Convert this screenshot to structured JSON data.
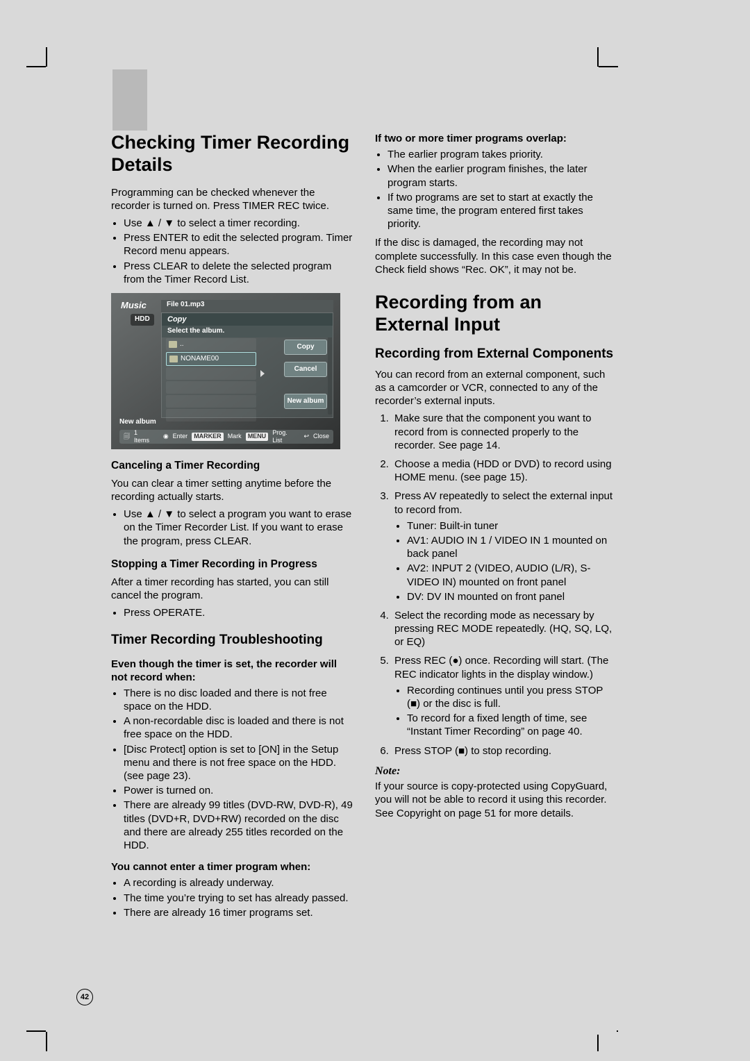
{
  "page_number": "42",
  "osd": {
    "music_label": "Music",
    "hdd_label": "HDD",
    "filebar": "File 01.mp3",
    "win_title": "Copy",
    "win_sub": "Select the album.",
    "row_up": "..",
    "row_noname": "NONAME00",
    "btn_copy": "Copy",
    "btn_cancel": "Cancel",
    "btn_newalbum": "New album",
    "new_album_side": "New album",
    "footer_items": "1 Items",
    "footer_enter": "Enter",
    "footer_marker": "MARKER",
    "footer_mark": "Mark",
    "footer_menu": "MENU",
    "footer_proglist": "Prog. List",
    "footer_close": "Close"
  },
  "col1": {
    "h1": "Checking Timer Recording Details",
    "p_intro": "Programming can be checked whenever the recorder is turned on. Press TIMER REC twice.",
    "b_intro": [
      "Use ▲ / ▼ to select a timer recording.",
      "Press ENTER to edit the selected program. Timer Record menu appears.",
      "Press CLEAR to delete the selected program from the Timer Record List."
    ],
    "h3_cancel": "Canceling a Timer Recording",
    "p_cancel": "You can clear a timer setting anytime before the recording actually starts.",
    "b_cancel": [
      "Use ▲ / ▼ to select a program you want to erase on the Timer Recorder List. If you want to erase the program, press CLEAR."
    ],
    "h3_stop": "Stopping a Timer Recording in Progress",
    "p_stop": "After a timer recording has started, you can still cancel the program.",
    "b_stop": [
      "Press OPERATE."
    ],
    "h2_trouble": "Timer Recording Troubleshooting",
    "h4_even": "Even though the timer is set, the recorder will not record when:",
    "b_even": [
      "There is no disc loaded and there is not free space on the HDD.",
      "A non-recordable disc is loaded and there is not free space on the HDD.",
      "[Disc Protect] option is set to [ON] in the Setup menu and there is not free space on the HDD. (see page 23).",
      "Power is turned on.",
      "There are already 99 titles (DVD-RW, DVD-R), 49 titles (DVD+R, DVD+RW) recorded on the disc and there are already 255 titles recorded on the HDD."
    ],
    "h4_cannot": "You cannot enter a timer program when:",
    "b_cannot": [
      "A recording is already underway.",
      "The time you’re trying to set has already passed.",
      "There are already 16 timer programs set."
    ]
  },
  "col2": {
    "h4_overlap": "If two or more timer programs overlap:",
    "b_overlap": [
      "The earlier program takes priority.",
      "When the earlier program finishes, the later program starts.",
      "If two programs are set to start at exactly the same time, the program entered first takes priority."
    ],
    "p_damaged": "If the disc is damaged, the recording may not complete successfully. In this case even though the Check field shows “Rec. OK”, it may not be.",
    "h1_ext": "Recording from an External Input",
    "h2_ext_comp": "Recording from External Components",
    "p_ext_intro": "You can record from an external component, such as a camcorder or VCR, connected to any of the recorder’s external inputs.",
    "steps": [
      "Make sure that the component you want to record from is connected properly to the recorder. See page 14.",
      "Choose a media (HDD or DVD) to record using HOME menu. (see page 15).",
      "Press AV repeatedly to select the external input to record from.",
      "Select the recording mode as necessary by pressing REC MODE repeatedly. (HQ, SQ, LQ, or EQ)",
      "Press REC (●) once.\nRecording will start. (The REC indicator lights in the display window.)",
      "Press STOP (■) to stop recording."
    ],
    "step3_sub": [
      "Tuner: Built-in tuner",
      "AV1: AUDIO IN 1 / VIDEO IN 1 mounted on back panel",
      "AV2: INPUT 2 (VIDEO, AUDIO (L/R), S-VIDEO IN) mounted on front panel",
      "DV: DV IN mounted on front panel"
    ],
    "step5_sub": [
      "Recording continues until you press STOP (■) or the disc is full.",
      "To record for a fixed length of time, see “Instant Timer Recording” on page 40."
    ],
    "note_label": "Note:",
    "note_body": "If your source is copy-protected using CopyGuard, you will not be able to record it using this recorder. See Copyright on page 51 for more details."
  }
}
